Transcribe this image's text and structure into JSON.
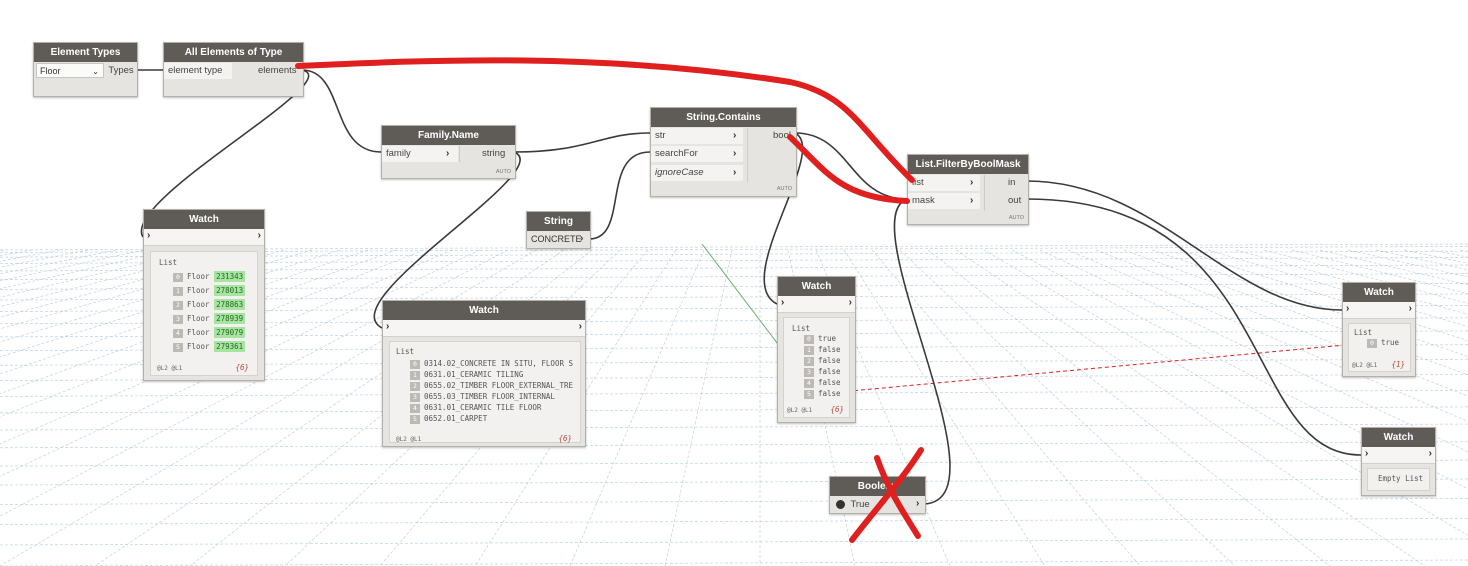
{
  "nodes": {
    "element_types": {
      "title": "Element Types",
      "dropdown_value": "Floor",
      "output": "Types"
    },
    "all_elements": {
      "title": "All Elements of Type",
      "input": "element type",
      "output": "elements"
    },
    "family_name": {
      "title": "Family.Name",
      "input": "family",
      "output": "string",
      "lacing": "AUTO"
    },
    "string": {
      "title": "String",
      "value": "CONCRETE"
    },
    "string_contains": {
      "title": "String.Contains",
      "inputs": [
        "str",
        "searchFor",
        "ignoreCase"
      ],
      "output": "bool",
      "lacing": "AUTO"
    },
    "filter": {
      "title": "List.FilterByBoolMask",
      "inputs": [
        "list",
        "mask"
      ],
      "outputs": [
        "in",
        "out"
      ],
      "lacing": "AUTO"
    },
    "boolean": {
      "title": "Boolean",
      "value": "True"
    }
  },
  "watches": {
    "w1": {
      "title": "Watch",
      "list_label": "List",
      "rows": [
        {
          "i": "0",
          "name": "Floor",
          "id": "231343"
        },
        {
          "i": "1",
          "name": "Floor",
          "id": "278013"
        },
        {
          "i": "2",
          "name": "Floor",
          "id": "278863"
        },
        {
          "i": "3",
          "name": "Floor",
          "id": "278939"
        },
        {
          "i": "4",
          "name": "Floor",
          "id": "279079"
        },
        {
          "i": "5",
          "name": "Floor",
          "id": "279361"
        }
      ],
      "levels": "@L2 @L1",
      "count": "{6}"
    },
    "w2": {
      "title": "Watch",
      "list_label": "List",
      "rows": [
        {
          "i": "0",
          "text": "0314.02_CONCRETE IN SITU, FLOOR S"
        },
        {
          "i": "1",
          "text": "0631.01_CERAMIC TILING"
        },
        {
          "i": "2",
          "text": "0655.02_TIMBER FLOOR_EXTERNAL_TRE"
        },
        {
          "i": "3",
          "text": "0655.03_TIMBER FLOOR_INTERNAL"
        },
        {
          "i": "4",
          "text": "0631.01_CERAMIC TILE FLOOR"
        },
        {
          "i": "5",
          "text": "0652.01_CARPET"
        }
      ],
      "levels": "@L2 @L1",
      "count": "{6}"
    },
    "w3": {
      "title": "Watch",
      "list_label": "List",
      "rows": [
        {
          "i": "0",
          "text": "true"
        },
        {
          "i": "1",
          "text": "false"
        },
        {
          "i": "2",
          "text": "false"
        },
        {
          "i": "3",
          "text": "false"
        },
        {
          "i": "4",
          "text": "false"
        },
        {
          "i": "5",
          "text": "false"
        }
      ],
      "levels": "@L2 @L1",
      "count": "{6}"
    },
    "w4": {
      "title": "Watch",
      "list_label": "List",
      "rows": [
        {
          "i": "0",
          "text": "true"
        }
      ],
      "levels": "@L2 @L1",
      "count": "{1}"
    },
    "w5": {
      "title": "Watch",
      "empty_text": "Empty List"
    }
  },
  "colors": {
    "node_header": "#5f5c58",
    "node_body": "#e6e4e1",
    "wire": "#3a3a3a",
    "highlight": "#e01f1f",
    "grid": "#a9c2d4"
  }
}
